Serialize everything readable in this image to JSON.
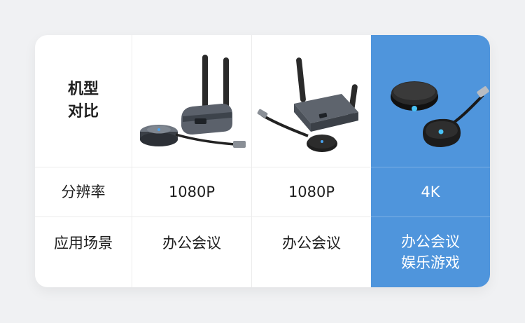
{
  "table": {
    "header_label_line1": "机型",
    "header_label_line2": "对比",
    "rows": [
      {
        "label": "分辨率",
        "values": [
          "1080P",
          "1080P",
          "4K"
        ]
      },
      {
        "label": "应用场景",
        "values": [
          "办公会议",
          "办公会议",
          "办公会议"
        ],
        "extra_last": "娱乐游戏"
      }
    ]
  },
  "products": [
    {
      "icon": "wireless-hdmi-kit-dual-antenna-icon"
    },
    {
      "icon": "wireless-hdmi-kit-angled-antenna-icon"
    },
    {
      "icon": "wireless-4k-puck-dongle-icon"
    }
  ],
  "colors": {
    "highlight": "#4f95dc",
    "background": "#f0f1f3",
    "card": "#ffffff"
  }
}
